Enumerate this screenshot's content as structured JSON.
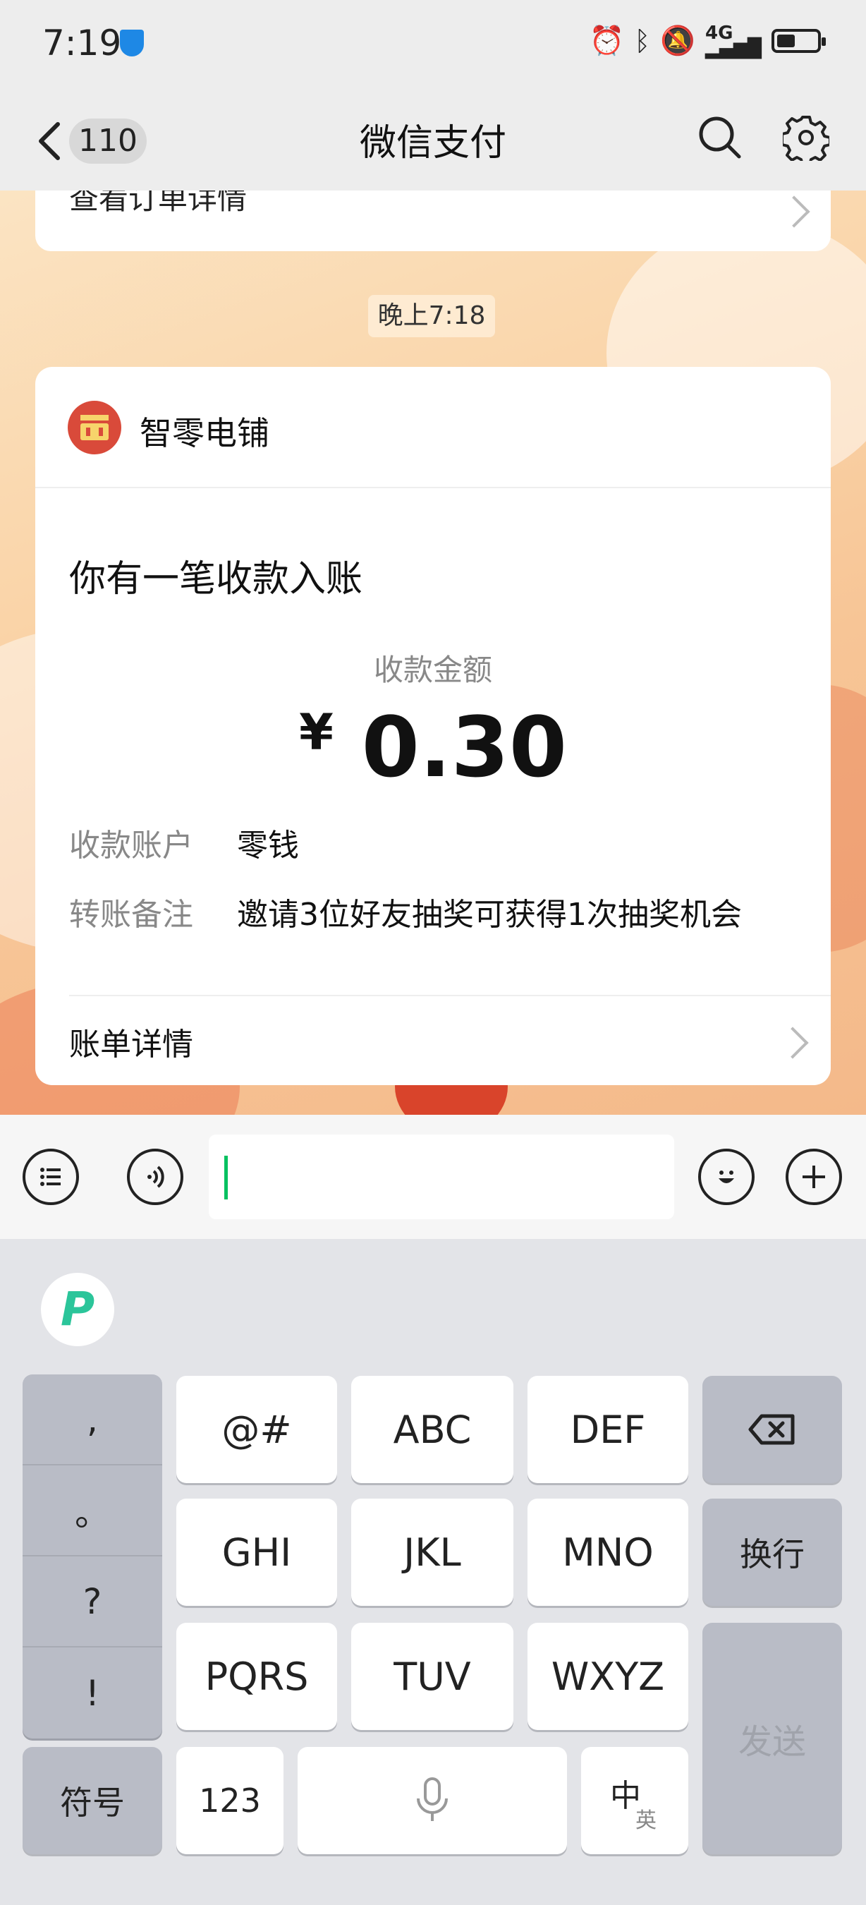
{
  "status_bar": {
    "time": "7:19",
    "icons": [
      "alarm-icon",
      "bluetooth-icon",
      "mute-icon",
      "4g-signal-icon",
      "battery-icon"
    ]
  },
  "nav": {
    "unread_count": "110",
    "title": "微信支付"
  },
  "chat": {
    "prev_card_label": "查看订单详情",
    "timestamp": "晚上7:18",
    "card": {
      "merchant": "智零电铺",
      "notice": "你有一笔收款入账",
      "amount_label": "收款金额",
      "currency": "¥",
      "amount": "0.30",
      "account_label": "收款账户",
      "account_value": "零钱",
      "remark_label": "转账备注",
      "remark_value": "邀请3位好友抽奖可获得1次抽奖机会",
      "bill_detail": "账单详情"
    }
  },
  "input_bar": {
    "value": ""
  },
  "keyboard": {
    "punct": [
      ",",
      "。",
      "?",
      "!"
    ],
    "rows": [
      [
        "@#",
        "ABC",
        "DEF"
      ],
      [
        "GHI",
        "JKL",
        "MNO"
      ],
      [
        "PQRS",
        "TUV",
        "WXYZ"
      ]
    ],
    "newline": "换行",
    "send": "发送",
    "symbols": "符号",
    "numbers": "123",
    "lang_main": "中",
    "lang_alt": "英"
  }
}
